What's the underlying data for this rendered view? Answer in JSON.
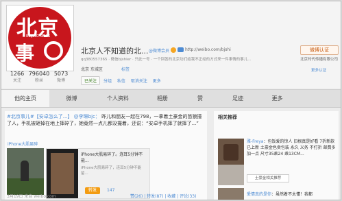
{
  "profile": {
    "avatar_text_top": "北京",
    "avatar_text_en": "BEIJING NEWS",
    "avatar_text_bottom": "事",
    "name": "北京人不知道的北...",
    "auth_tag": "@微博会员",
    "url": "http://weibo.com/bjshi",
    "desc": "qq380557365 · 微信bjshier · 只此一号 · 一个回答的北京坊们给我不正经的方式来一件事情的事儿...",
    "location": "北京 东城区",
    "tags_label": "标签",
    "stats": [
      {
        "num": "1266",
        "label": "关注"
      },
      {
        "num": "796040",
        "label": "粉丝"
      },
      {
        "num": "5073",
        "label": "微博"
      }
    ],
    "actions": {
      "followed": "已关注",
      "group": "分组",
      "message": "私信",
      "unfollow": "取消关注",
      "more": "更多"
    },
    "fan_button": "微博认证",
    "fan_mini": "北京时代传播有限公司",
    "auth_link": "更多认证"
  },
  "tabs": [
    "他的主页",
    "微博",
    "个人资料",
    "相册",
    "赞",
    "足迹",
    "更多"
  ],
  "post": {
    "text_a": "#北京事儿#【安卓怎么了...】",
    "mention": "@李琳bjc：",
    "text_b": "昨儿和朋友一起在798，一拿着土豪金的苗狼撞了人，手机被砸掉在地上摔碎了，她竟然一点儿都没撮着，还说：“安卓手机摔了就摔了...”",
    "ref_link": "iPhone大肌易碎",
    "card_title": "iPhone大肌易碎了。连耳5分钟不能...",
    "card_sub": "iPhone大肌易碎了，连耳5分钟不能留...",
    "card_button": "转发",
    "card_likes": "147",
    "time": "3月19日 来自 weibo.com",
    "stats": "赞(26) | 转发(87) | 收藏 | 评论(33)"
  },
  "sidebar": {
    "title": "相关推荐",
    "rec_text_1": "雅-Freya",
    "rec_text_2": "：包饭爱的惊人 旧根真是好看 7折新款已上新 土豪金色卖包装 永久 义务 不打折 邮费多加一点 尺寸35乘24 乘13CM...",
    "more_btn": "土豪金相关推荐",
    "rec3_user": "愛情真的是你",
    "rec3_text": "：虽然着不太懂！我都"
  },
  "colors": {
    "brand": "#c8161d",
    "link": "#4d8bd3",
    "accent": "#f39c12"
  }
}
